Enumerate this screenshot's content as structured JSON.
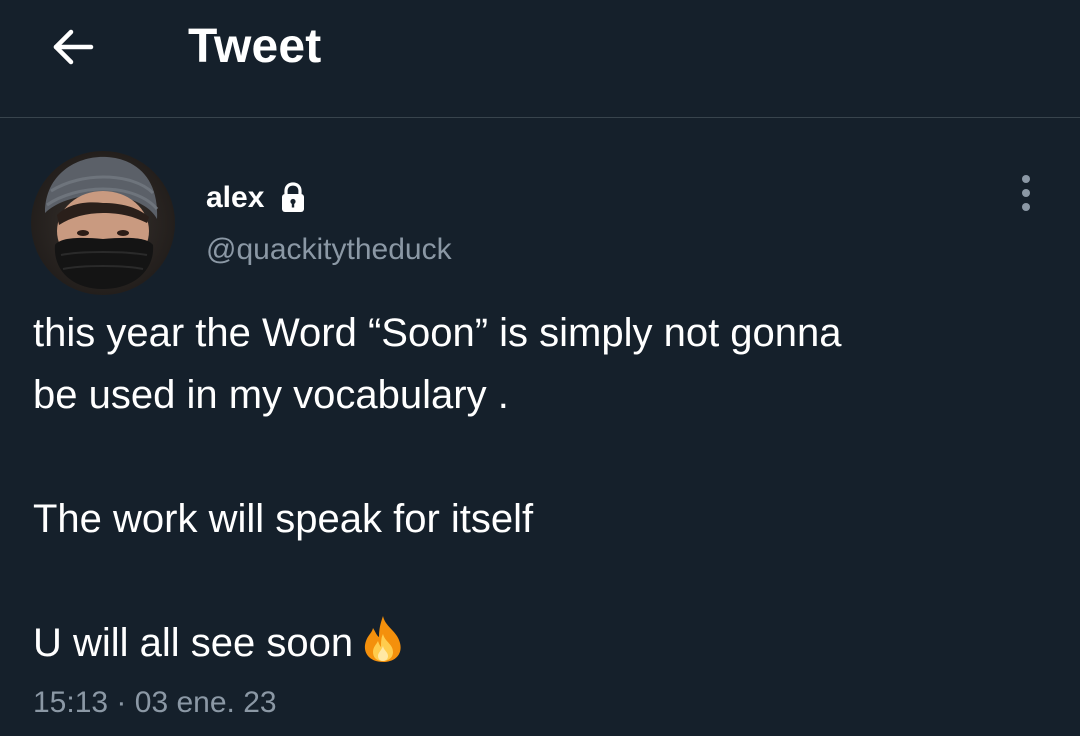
{
  "header": {
    "back_icon": "arrow-left-icon",
    "title": "Tweet"
  },
  "tweet": {
    "author": {
      "display_name": "alex",
      "protected_icon": "lock-icon",
      "handle": "@quackitytheduck",
      "avatar": "avatar"
    },
    "more_icon": "more-vertical-icon",
    "lines": [
      "this year the Word “Soon” is simply not gonna",
      "be used in my vocabulary .",
      "",
      "The work will speak for itself",
      "",
      "U will all see soon"
    ],
    "emoji": "fire-icon",
    "time": "15:13",
    "separator": "·",
    "date": "03 ene. 23"
  },
  "colors": {
    "background": "#15202b",
    "text": "#ffffff",
    "secondary_text": "#8b98a5",
    "divider": "#38444d"
  }
}
